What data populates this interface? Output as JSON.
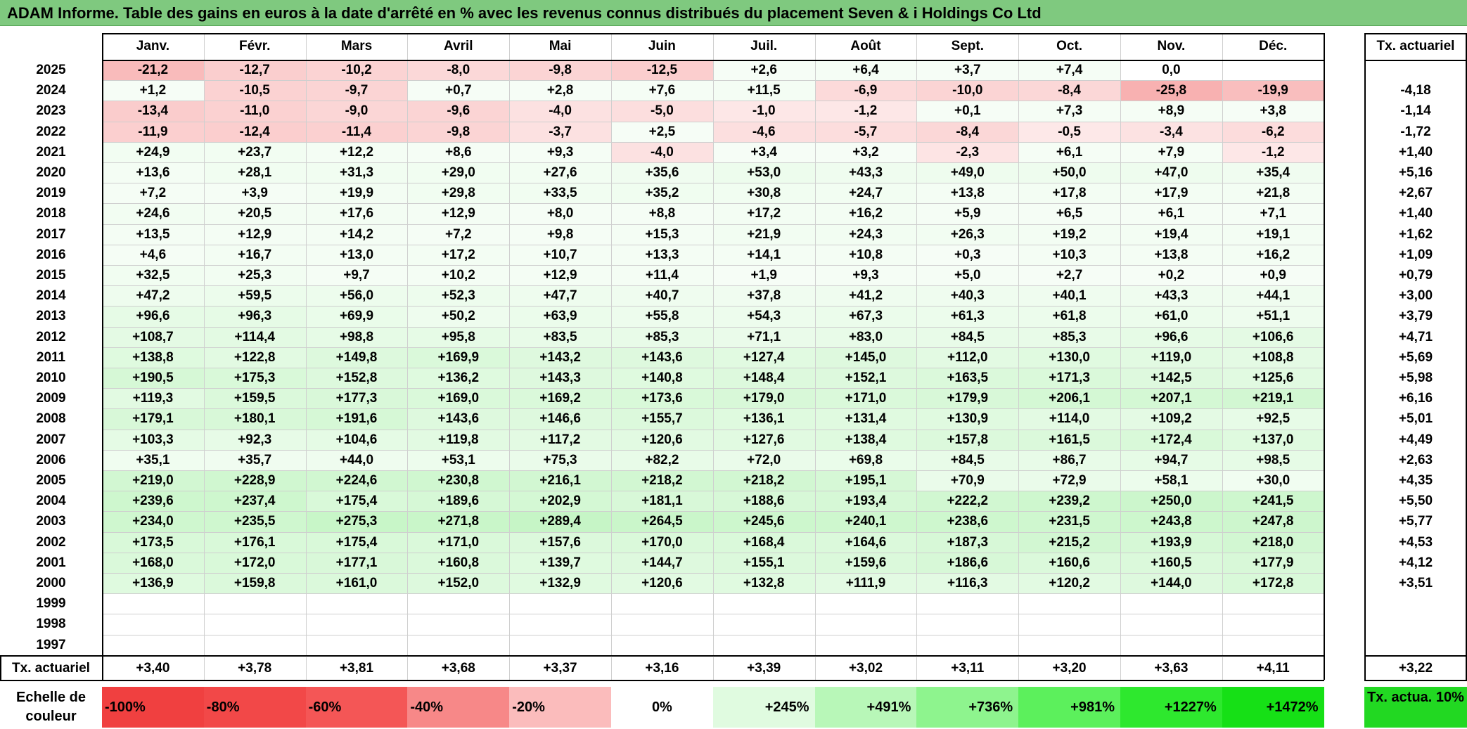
{
  "title": "ADAM Informe. Table des gains en euros à la date d'arrêté en % avec les revenus connus distribués du placement Seven & i Holdings Co Ltd",
  "chart_data": {
    "type": "table",
    "columns": [
      "Janv.",
      "Févr.",
      "Mars",
      "Avril",
      "Mai",
      "Juin",
      "Juil.",
      "Août",
      "Sept.",
      "Oct.",
      "Nov.",
      "Déc."
    ],
    "rate_column_header": "Tx. actuariel",
    "rows": [
      {
        "year": "2025",
        "values": [
          "-21,2",
          "-12,7",
          "-10,2",
          "-8,0",
          "-9,8",
          "-12,5",
          "+2,6",
          "+6,4",
          "+3,7",
          "+7,4",
          "0,0",
          ""
        ],
        "rate": ""
      },
      {
        "year": "2024",
        "values": [
          "+1,2",
          "-10,5",
          "-9,7",
          "+0,7",
          "+2,8",
          "+7,6",
          "+11,5",
          "-6,9",
          "-10,0",
          "-8,4",
          "-25,8",
          "-19,9"
        ],
        "rate": "-4,18"
      },
      {
        "year": "2023",
        "values": [
          "-13,4",
          "-11,0",
          "-9,0",
          "-9,6",
          "-4,0",
          "-5,0",
          "-1,0",
          "-1,2",
          "+0,1",
          "+7,3",
          "+8,9",
          "+3,8"
        ],
        "rate": "-1,14"
      },
      {
        "year": "2022",
        "values": [
          "-11,9",
          "-12,4",
          "-11,4",
          "-9,8",
          "-3,7",
          "+2,5",
          "-4,6",
          "-5,7",
          "-8,4",
          "-0,5",
          "-3,4",
          "-6,2"
        ],
        "rate": "-1,72"
      },
      {
        "year": "2021",
        "values": [
          "+24,9",
          "+23,7",
          "+12,2",
          "+8,6",
          "+9,3",
          "-4,0",
          "+3,4",
          "+3,2",
          "-2,3",
          "+6,1",
          "+7,9",
          "-1,2"
        ],
        "rate": "+1,40"
      },
      {
        "year": "2020",
        "values": [
          "+13,6",
          "+28,1",
          "+31,3",
          "+29,0",
          "+27,6",
          "+35,6",
          "+53,0",
          "+43,3",
          "+49,0",
          "+50,0",
          "+47,0",
          "+35,4"
        ],
        "rate": "+5,16"
      },
      {
        "year": "2019",
        "values": [
          "+7,2",
          "+3,9",
          "+19,9",
          "+29,8",
          "+33,5",
          "+35,2",
          "+30,8",
          "+24,7",
          "+13,8",
          "+17,8",
          "+17,9",
          "+21,8"
        ],
        "rate": "+2,67"
      },
      {
        "year": "2018",
        "values": [
          "+24,6",
          "+20,5",
          "+17,6",
          "+12,9",
          "+8,0",
          "+8,8",
          "+17,2",
          "+16,2",
          "+5,9",
          "+6,5",
          "+6,1",
          "+7,1"
        ],
        "rate": "+1,40"
      },
      {
        "year": "2017",
        "values": [
          "+13,5",
          "+12,9",
          "+14,2",
          "+7,2",
          "+9,8",
          "+15,3",
          "+21,9",
          "+24,3",
          "+26,3",
          "+19,2",
          "+19,4",
          "+19,1"
        ],
        "rate": "+1,62"
      },
      {
        "year": "2016",
        "values": [
          "+4,6",
          "+16,7",
          "+13,0",
          "+17,2",
          "+10,7",
          "+13,3",
          "+14,1",
          "+10,8",
          "+0,3",
          "+10,3",
          "+13,8",
          "+16,2"
        ],
        "rate": "+1,09"
      },
      {
        "year": "2015",
        "values": [
          "+32,5",
          "+25,3",
          "+9,7",
          "+10,2",
          "+12,9",
          "+11,4",
          "+1,9",
          "+9,3",
          "+5,0",
          "+2,7",
          "+0,2",
          "+0,9"
        ],
        "rate": "+0,79"
      },
      {
        "year": "2014",
        "values": [
          "+47,2",
          "+59,5",
          "+56,0",
          "+52,3",
          "+47,7",
          "+40,7",
          "+37,8",
          "+41,2",
          "+40,3",
          "+40,1",
          "+43,3",
          "+44,1"
        ],
        "rate": "+3,00"
      },
      {
        "year": "2013",
        "values": [
          "+96,6",
          "+96,3",
          "+69,9",
          "+50,2",
          "+63,9",
          "+55,8",
          "+54,3",
          "+67,3",
          "+61,3",
          "+61,8",
          "+61,0",
          "+51,1"
        ],
        "rate": "+3,79"
      },
      {
        "year": "2012",
        "values": [
          "+108,7",
          "+114,4",
          "+98,8",
          "+95,8",
          "+83,5",
          "+85,3",
          "+71,1",
          "+83,0",
          "+84,5",
          "+85,3",
          "+96,6",
          "+106,6"
        ],
        "rate": "+4,71"
      },
      {
        "year": "2011",
        "values": [
          "+138,8",
          "+122,8",
          "+149,8",
          "+169,9",
          "+143,2",
          "+143,6",
          "+127,4",
          "+145,0",
          "+112,0",
          "+130,0",
          "+119,0",
          "+108,8"
        ],
        "rate": "+5,69"
      },
      {
        "year": "2010",
        "values": [
          "+190,5",
          "+175,3",
          "+152,8",
          "+136,2",
          "+143,3",
          "+140,8",
          "+148,4",
          "+152,1",
          "+163,5",
          "+171,3",
          "+142,5",
          "+125,6"
        ],
        "rate": "+5,98"
      },
      {
        "year": "2009",
        "values": [
          "+119,3",
          "+159,5",
          "+177,3",
          "+169,0",
          "+169,2",
          "+173,6",
          "+179,0",
          "+171,0",
          "+179,9",
          "+206,1",
          "+207,1",
          "+219,1"
        ],
        "rate": "+6,16"
      },
      {
        "year": "2008",
        "values": [
          "+179,1",
          "+180,1",
          "+191,6",
          "+143,6",
          "+146,6",
          "+155,7",
          "+136,1",
          "+131,4",
          "+130,9",
          "+114,0",
          "+109,2",
          "+92,5"
        ],
        "rate": "+5,01"
      },
      {
        "year": "2007",
        "values": [
          "+103,3",
          "+92,3",
          "+104,6",
          "+119,8",
          "+117,2",
          "+120,6",
          "+127,6",
          "+138,4",
          "+157,8",
          "+161,5",
          "+172,4",
          "+137,0"
        ],
        "rate": "+4,49"
      },
      {
        "year": "2006",
        "values": [
          "+35,1",
          "+35,7",
          "+44,0",
          "+53,1",
          "+75,3",
          "+82,2",
          "+72,0",
          "+69,8",
          "+84,5",
          "+86,7",
          "+94,7",
          "+98,5"
        ],
        "rate": "+2,63"
      },
      {
        "year": "2005",
        "values": [
          "+219,0",
          "+228,9",
          "+224,6",
          "+230,8",
          "+216,1",
          "+218,2",
          "+218,2",
          "+195,1",
          "+70,9",
          "+72,9",
          "+58,1",
          "+30,0"
        ],
        "rate": "+4,35"
      },
      {
        "year": "2004",
        "values": [
          "+239,6",
          "+237,4",
          "+175,4",
          "+189,6",
          "+202,9",
          "+181,1",
          "+188,6",
          "+193,4",
          "+222,2",
          "+239,2",
          "+250,0",
          "+241,5"
        ],
        "rate": "+5,50"
      },
      {
        "year": "2003",
        "values": [
          "+234,0",
          "+235,5",
          "+275,3",
          "+271,8",
          "+289,4",
          "+264,5",
          "+245,6",
          "+240,1",
          "+238,6",
          "+231,5",
          "+243,8",
          "+247,8"
        ],
        "rate": "+5,77"
      },
      {
        "year": "2002",
        "values": [
          "+173,5",
          "+176,1",
          "+175,4",
          "+171,0",
          "+157,6",
          "+170,0",
          "+168,4",
          "+164,6",
          "+187,3",
          "+215,2",
          "+193,9",
          "+218,0"
        ],
        "rate": "+4,53"
      },
      {
        "year": "2001",
        "values": [
          "+168,0",
          "+172,0",
          "+177,1",
          "+160,8",
          "+139,7",
          "+144,7",
          "+155,1",
          "+159,6",
          "+186,6",
          "+160,6",
          "+160,5",
          "+177,9"
        ],
        "rate": "+4,12"
      },
      {
        "year": "2000",
        "values": [
          "+136,9",
          "+159,8",
          "+161,0",
          "+152,0",
          "+132,9",
          "+120,6",
          "+132,8",
          "+111,9",
          "+116,3",
          "+120,2",
          "+144,0",
          "+172,8"
        ],
        "rate": "+3,51"
      },
      {
        "year": "1999",
        "values": [
          "",
          "",
          "",
          "",
          "",
          "",
          "",
          "",
          "",
          "",
          "",
          ""
        ],
        "rate": ""
      },
      {
        "year": "1998",
        "values": [
          "",
          "",
          "",
          "",
          "",
          "",
          "",
          "",
          "",
          "",
          "",
          ""
        ],
        "rate": ""
      },
      {
        "year": "1997",
        "values": [
          "",
          "",
          "",
          "",
          "",
          "",
          "",
          "",
          "",
          "",
          "",
          ""
        ],
        "rate": ""
      }
    ],
    "summary_row": {
      "label": "Tx. actuariel",
      "values": [
        "+3,40",
        "+3,78",
        "+3,81",
        "+3,68",
        "+3,37",
        "+3,16",
        "+3,39",
        "+3,02",
        "+3,11",
        "+3,20",
        "+3,63",
        "+4,11"
      ],
      "rate": "+3,22"
    },
    "legend": {
      "label": "Echelle de couleur",
      "items": [
        "-100%",
        "-80%",
        "-60%",
        "-40%",
        "-20%",
        "0%",
        "+245%",
        "+491%",
        "+736%",
        "+981%",
        "+1227%",
        "+1472%"
      ],
      "item_colors": [
        "#f04040",
        "#f24848",
        "#f45656",
        "#f78888",
        "#fbbcbc",
        "#ffffff",
        "#e0fbe0",
        "#b8f7b8",
        "#8ef48e",
        "#5cf05c",
        "#2ee82e",
        "#16e016"
      ],
      "rate_item": "Tx. actua. 10%",
      "rate_item_color": "#22d822"
    },
    "colors": {
      "negative_min": "#f04040",
      "zero": "#ffffff",
      "positive_max": "#16e016",
      "title_bar": "#7fc97f"
    }
  }
}
